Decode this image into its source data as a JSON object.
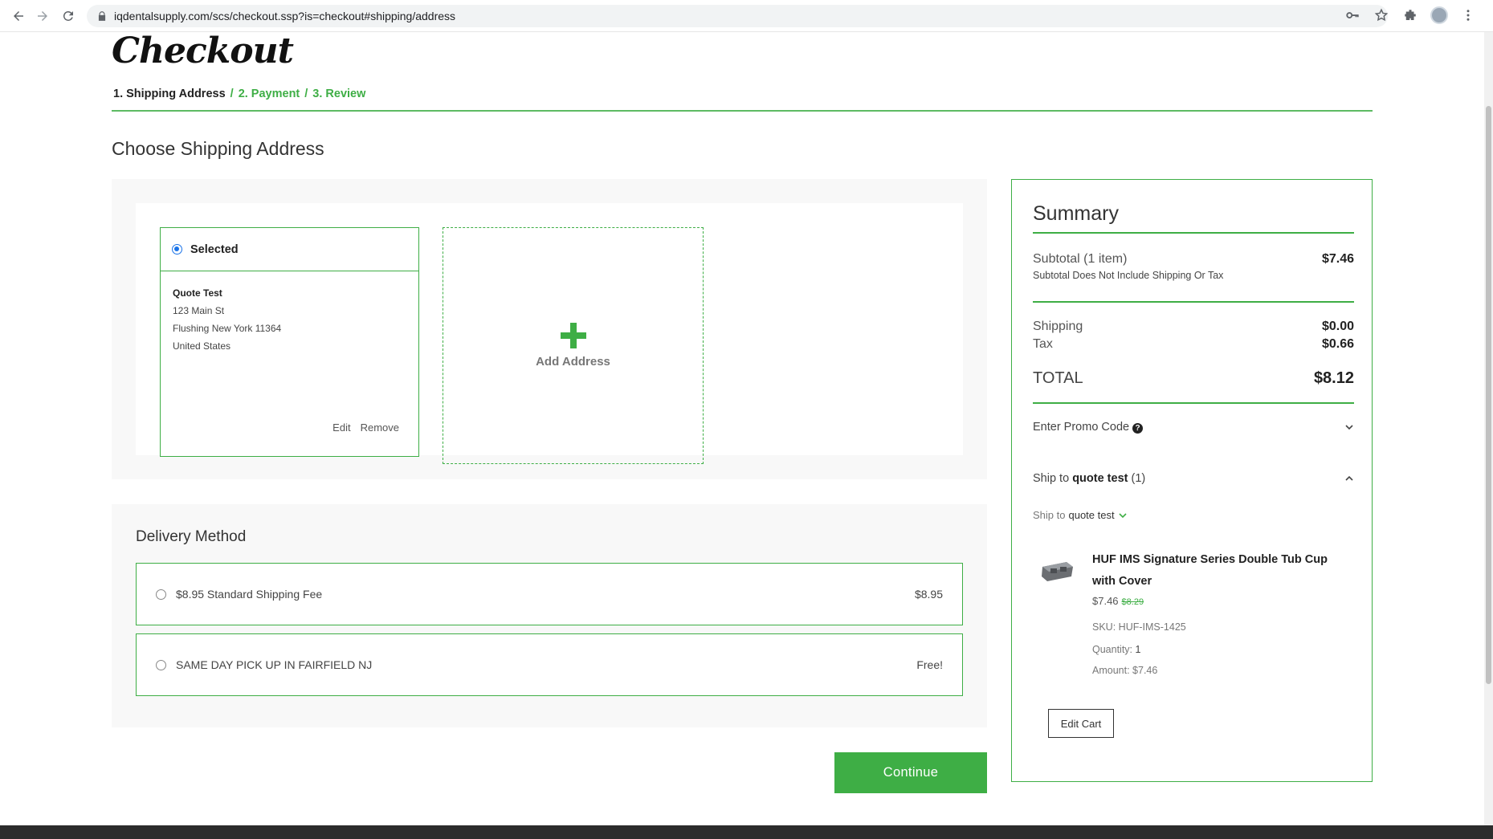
{
  "browser": {
    "url": "iqdentalsupply.com/scs/checkout.ssp?is=checkout#shipping/address"
  },
  "checkout": {
    "title": "Checkout",
    "steps": {
      "step1": "1. Shipping Address",
      "sep2": "/",
      "step2": "2. Payment",
      "sep3": "/",
      "step3": "3. Review"
    },
    "section_title": "Choose Shipping Address"
  },
  "address": {
    "selected_label": "Selected",
    "name": "Quote Test",
    "line1": "123 Main St",
    "line2": "Flushing New York 11364",
    "country": "United States",
    "edit": "Edit",
    "remove": "Remove",
    "add_label": "Add Address"
  },
  "delivery": {
    "title": "Delivery Method",
    "options": [
      {
        "label": "$8.95 Standard Shipping Fee",
        "price": "$8.95"
      },
      {
        "label": "SAME DAY PICK UP IN FAIRFIELD NJ",
        "price": "Free!"
      }
    ]
  },
  "continue_label": "Continue",
  "summary": {
    "title": "Summary",
    "subtotal_label": "Subtotal",
    "subtotal_count": "(1 item)",
    "subtotal_value": "$7.46",
    "subtotal_note": "Subtotal Does Not Include Shipping Or Tax",
    "shipping_label": "Shipping",
    "shipping_value": "$0.00",
    "tax_label": "Tax",
    "tax_value": "$0.66",
    "total_label": "TOTAL",
    "total_value": "$8.12",
    "promo_label": "Enter Promo Code",
    "shipto_prefix": "Ship to",
    "shipto_name": "quote test",
    "shipto_count": "(1)",
    "shipto_sub_prefix": "Ship to",
    "shipto_sub_name": "quote test",
    "product_name": "HUF IMS Signature Series Double Tub Cup with Cover",
    "product_price": "$7.46",
    "product_old_price": "$8.29",
    "sku_label": "SKU:",
    "sku_value": "HUF-IMS-1425",
    "qty_label": "Quantity:",
    "qty_value": "1",
    "amount_label": "Amount:",
    "amount_value": "$7.46",
    "edit_cart": "Edit Cart"
  },
  "colors": {
    "accent": "#3eae45",
    "selected_radio": "#1a73e8"
  }
}
